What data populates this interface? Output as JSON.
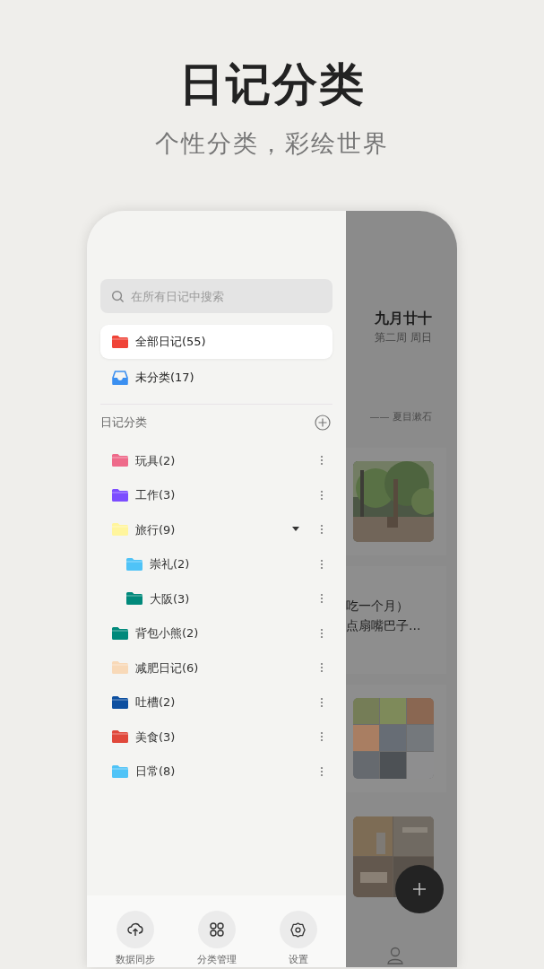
{
  "header": {
    "title": "日记分类",
    "subtitle": "个性分类，彩绘世界"
  },
  "drawer": {
    "search": {
      "placeholder": "在所有日记中搜索"
    },
    "quick_items": [
      {
        "kind": "folder",
        "label": "全部日记(55)",
        "selected": true,
        "color": "#f04438"
      },
      {
        "kind": "inbox",
        "label": "未分类(17)",
        "selected": false,
        "color": "#3b8ff0"
      }
    ],
    "section": {
      "title": "日记分类"
    },
    "categories": [
      {
        "label": "玩具(2)",
        "color": "#ee6a8a"
      },
      {
        "label": "工作(3)",
        "color": "#7c4dff"
      },
      {
        "label": "旅行(9)",
        "color": "#fff59d",
        "expanded": true,
        "children": [
          {
            "label": "崇礼(2)",
            "color": "#4fc3f7"
          },
          {
            "label": "大阪(3)",
            "color": "#00897b"
          }
        ]
      },
      {
        "label": "背包小熊(2)",
        "color": "#00897b"
      },
      {
        "label": "减肥日记(6)",
        "color": "#f8d9b8"
      },
      {
        "label": "吐槽(2)",
        "color": "#0d4fa0"
      },
      {
        "label": "美食(3)",
        "color": "#e0483b"
      },
      {
        "label": "日常(8)",
        "color": "#4fc3f7"
      }
    ],
    "bottom_bar": [
      {
        "kind": "sync",
        "label": "数据同步"
      },
      {
        "kind": "grid",
        "label": "分类管理"
      },
      {
        "kind": "settings",
        "label": "设置"
      }
    ]
  },
  "background_page": {
    "date": "九月廿十",
    "week": "第二周 周日",
    "quote": "—— 夏目漱石",
    "entries": [
      {
        "kind": "picture"
      },
      {
        "kind": "text",
        "lines": [
          "吃一个月）",
          "点扇嘴巴子..."
        ]
      },
      {
        "kind": "picture"
      },
      {
        "kind": "picture"
      }
    ]
  }
}
